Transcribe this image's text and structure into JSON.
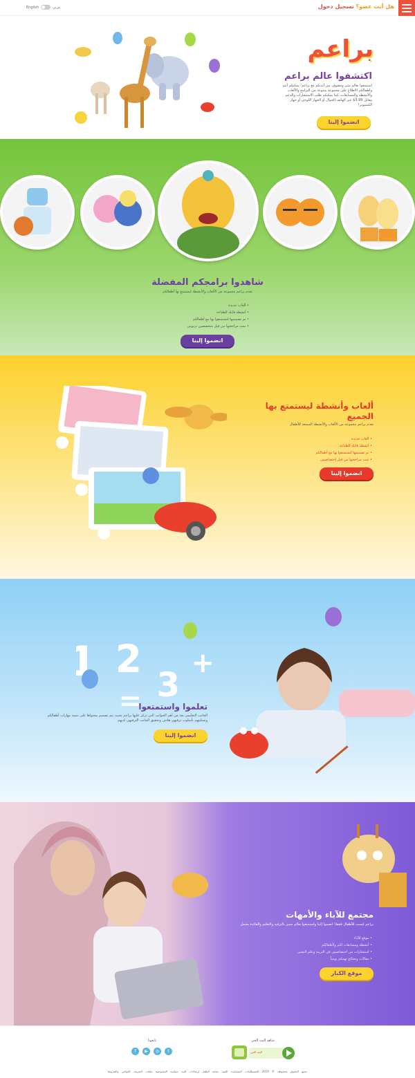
{
  "header": {
    "member_question": "هل أنت عضو؟",
    "login_label": "تسجيل دخول",
    "lang_ar": "عربي",
    "lang_en": "English"
  },
  "intro": {
    "logo": "براعم",
    "title": "اكتشفوا عالم براعم",
    "desc": "استمتعوا بعالم مثير ومشوق، بين أيديكم مع براعم! يمكنكم أنتم وأطفالكم الاطلاع على مجموعة متنوعة من البرامج والألعاب والأنشطة والمسابقات، كما يمكنكم طلب الاستشارات والدعم مقابل 3.99$ عبر الهاتف الجوال أو الجهاز اللوحي أو جهاز الكمبيوتر!",
    "cta": "انضموا إلينا"
  },
  "shows": {
    "title": "شاهدوا برامجكم المفضلة",
    "subtitle": "تقدم براعم مجموعة من الألعاب والأنشطة ليستمتع بها أطفالكم",
    "features": [
      "ألعاب جديدة",
      "أنشطة قابلة للطباعة",
      "تم تصميمها لتستمتعوا بها مع أطفالكم",
      "تمت مراجعتها من قبل متخصصين تربويين"
    ],
    "cta": "انضموا إلينا"
  },
  "games": {
    "title": "ألعاب وأنشطة ليستمتع بها الجميع",
    "subtitle": "تقدم براعم مجموعة من الألعاب والأنشطة الممتعة للأطفال",
    "features": [
      "ألعاب جديدة",
      "أنشطة قابلة للطباعة",
      "تم تصميمها لتستمتعوا بها مع أطفالكم",
      "تمت مراجعتها من قبل إختصاصيين"
    ],
    "cta": "انضموا إلينا"
  },
  "learn": {
    "title": "تعلموا واستمتعوا",
    "desc": "الجانب التعليمي يعد من أهم الجوانب التي تركز عليها براعم بحيث يتم تصميم محتواها على تنمية مهارات أطفالكم وتسليتهم بأسلوب ترفيهي هادف وتحقيق الجانب الترفيهي لديهم",
    "cta": "انضموا إلينا"
  },
  "parents": {
    "title": "مجتمع للآباء والأمهات",
    "subtitle": "براعم ليست للأطفال فقط! انضموا إلينا واستمتعوا بعالم مميز بالترفيه والتعليم والفائدة يشمل",
    "features": [
      "موقع للآباء",
      "أنشطة ومسابقات لكم ولأطفالكم",
      "استشارات من اختصاصيين في التربية وعلم النفس",
      "مقالات ونصائح تهمكم يومياً"
    ],
    "cta": "موقع الكبار"
  },
  "footer": {
    "watch_label": "شاهد البث الحي",
    "live_label": "البث الحي",
    "follow_label": "تابعونا",
    "social": [
      "twitter-icon",
      "instagram-icon",
      "youtube-icon",
      "facebook-icon"
    ],
    "links": "جميع الحقوق محفوظة © 2019 المصطلحات المساعدة الفنية حماية الطفل إرشادات البث سياسة الخصوصية ملفات التعريف القوانين والشروط"
  },
  "colors": {
    "brand_red": "#f0503a",
    "brand_purple": "#6a3fa0",
    "brand_yellow": "#fcd22e",
    "green_bg": "#74c43a",
    "blue_bg": "#8fd0f5"
  }
}
